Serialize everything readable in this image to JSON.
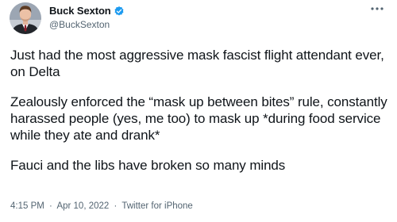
{
  "author": {
    "display_name": "Buck Sexton",
    "handle": "@BuckSexton",
    "verified": true
  },
  "icons": {
    "verified": "verified-badge-icon",
    "more": "more-options-icon",
    "avatar": "profile-photo"
  },
  "colors": {
    "verified_blue": "#1d9bf0",
    "text": "#0f1419",
    "secondary_text": "#536471"
  },
  "tweet": {
    "paragraphs": [
      "Just had the most aggressive mask fascist flight attendant ever, on Delta",
      "Zealously enforced the “mask up between bites” rule, constantly harassed people (yes, me too) to mask up *during food service while they ate and drank*",
      "Fauci and the libs have broken so many minds"
    ]
  },
  "meta": {
    "time": "4:15 PM",
    "date": "Apr 10, 2022",
    "separator": "·",
    "source": "Twitter for iPhone"
  }
}
